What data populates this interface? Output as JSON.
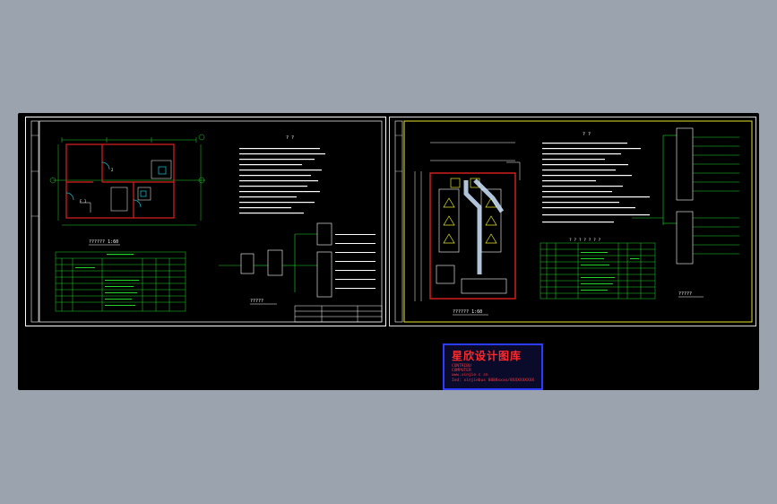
{
  "colors": {
    "background": "#9aa3ae",
    "canvas": "#000000",
    "frame": "#ffffff",
    "wire_green": "#22d62a",
    "wall_red": "#e02020",
    "door_cyan": "#10c8d8",
    "border_yellow": "#e6e62a",
    "stamp_blue": "#2b3cff",
    "stamp_red": "#ff2b2b"
  },
  "left_sheet": {
    "floor_plan_label": "??????  1:60",
    "schematic_label": "?????",
    "notes_heading": "? ?"
  },
  "right_sheet": {
    "layout_label": "??????  1:60",
    "schematic_label": "?????",
    "notes_heading": "? ?",
    "table_heading": "? ? ? ? ? ? ?"
  },
  "stamp": {
    "title": "星欣设计图库",
    "line1": "CONTRIBU",
    "line2": "COMPUTER",
    "line3": "www.xinjie c cn",
    "line4": "Ind: xinjiebus 8888xxxx/8XXXXXXXXX"
  }
}
